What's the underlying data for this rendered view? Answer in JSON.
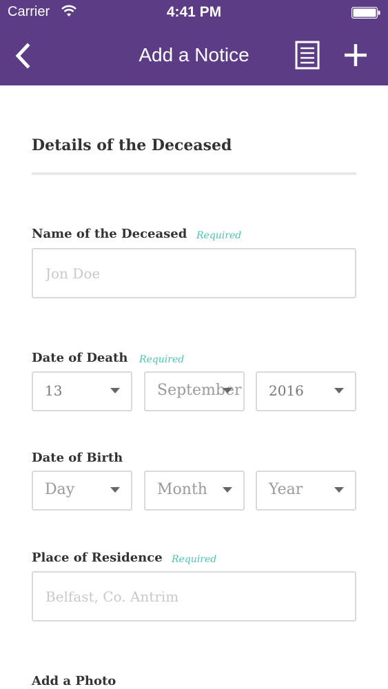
{
  "status_bar": {
    "carrier": "Carrier",
    "time": "4:41 PM"
  },
  "nav": {
    "title": "Add a Notice"
  },
  "colors": {
    "header_bg": "#5c3c84",
    "required_accent": "#4cc4b4"
  },
  "section": {
    "title": "Details of the Deceased"
  },
  "fields": {
    "name": {
      "label": "Name of the Deceased",
      "required": "Required",
      "placeholder": "Jon Doe",
      "value": ""
    },
    "date_of_death": {
      "label": "Date of Death",
      "required": "Required",
      "day": "13",
      "month": "September",
      "year": "2016"
    },
    "date_of_birth": {
      "label": "Date of Birth",
      "day": "Day",
      "month": "Month",
      "year": "Year"
    },
    "residence": {
      "label": "Place of Residence",
      "required": "Required",
      "placeholder": "Belfast, Co. Antrim",
      "value": ""
    },
    "photo": {
      "label": "Add a Photo"
    }
  },
  "icons": {
    "back": "chevron-left-icon",
    "list": "document-list-icon",
    "add": "plus-icon",
    "wifi": "wifi-icon",
    "battery": "battery-icon",
    "caret": "caret-down-icon"
  }
}
